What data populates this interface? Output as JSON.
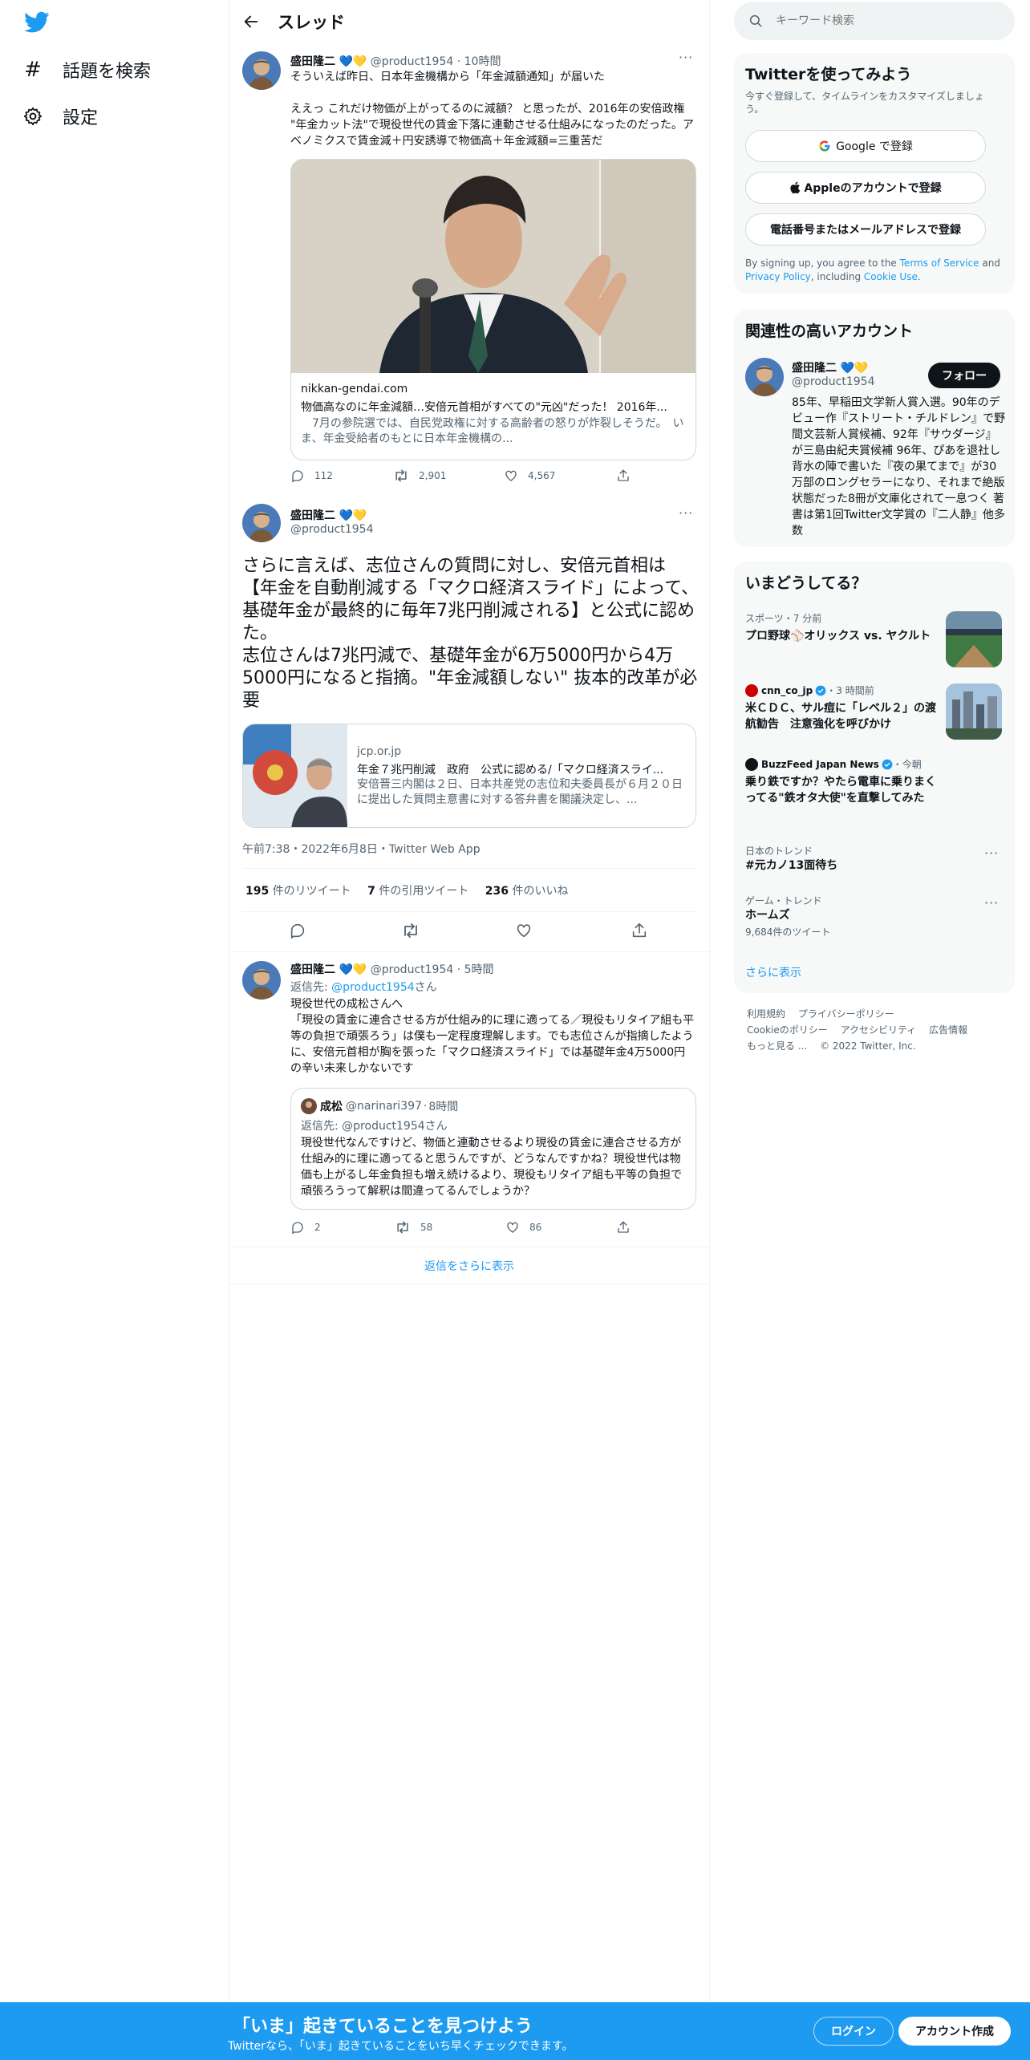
{
  "nav": {
    "explore_label": "話題を検索",
    "settings_label": "設定"
  },
  "header": {
    "title": "スレッド"
  },
  "tweet1": {
    "name": "盛田隆二",
    "handle": "@product1954",
    "time": "10時間",
    "text": "そういえば昨日、日本年金機構から「年金減額通知」が届いた\n\nええっ これだけ物価が上がってるのに減額？ と思ったが、2016年の安倍政権 \"年金カット法\"で現役世代の賃金下落に連動させる仕組みになったのだった。アベノミクスで賃金減＋円安誘導で物価高＋年金減額=三重苦だ",
    "card_domain": "nikkan-gendai.com",
    "card_title": "物価高なのに年金減額…安倍元首相がすべての\"元凶\"だった！ 2016年...",
    "card_desc": "　7月の参院選では、自民党政権に対する高齢者の怒りが炸裂しそうだ。　いま、年金受給者のもとに日本年金機構の...",
    "replies": "112",
    "retweets": "2,901",
    "likes": "4,567"
  },
  "tweet2": {
    "name": "盛田隆二",
    "handle": "@product1954",
    "text": "さらに言えば、志位さんの質問に対し、安倍元首相は【年金を自動削減する「マクロ経済スライド」によって、基礎年金が最終的に毎年7兆円削減される】と公式に認めた。\n志位さんは7兆円減で、基礎年金が6万5000円から4万5000円になると指摘。\"年金減額しない\" 抜本的改革が必要",
    "card_domain": "jcp.or.jp",
    "card_title": "年金７兆円削減　政府　公式に認める/「マクロ経済スライ...",
    "card_desc": "安倍晋三内閣は２日、日本共産党の志位和夫委員長が６月２０日に提出した質問主意書に対する答弁書を閣議決定し、...",
    "timestamp": "午前7:38・2022年6月8日・Twitter Web App",
    "rt_count": "195",
    "rt_label": "件のリツイート",
    "qt_count": "7",
    "qt_label": "件の引用ツイート",
    "like_count": "236",
    "like_label": "件のいいね"
  },
  "tweet3": {
    "name": "盛田隆二",
    "handle": "@product1954",
    "time": "5時間",
    "reply_prefix": "返信先: ",
    "reply_to": "@product1954",
    "reply_suffix": "さん",
    "text": "現役世代の成松さんへ\n「現役の賃金に連合させる方が仕組み的に理に適ってる／現役もリタイア組も平等の負担で頑張ろう」は僕も一定程度理解します。でも志位さんが指摘したように、安倍元首相が胸を張った「マクロ経済スライド」では基礎年金4万5000円の辛い未来しかないです",
    "quote_name": "成松",
    "quote_handle": "@narinari397",
    "quote_time": "8時間",
    "quote_reply": "返信先: @product1954さん",
    "quote_text": "現役世代なんですけど、物価と連動させるより現役の賃金に連合させる方が仕組み的に理に適ってると思うんですが、どうなんですかね？現役世代は物価も上がるし年金負担も増え続けるより、現役もリタイア組も平等の負担で頑張ろうって解釈は間違ってるんでしょうか？",
    "replies": "2",
    "retweets": "58",
    "likes": "86"
  },
  "show_more_replies": "返信をさらに表示",
  "search": {
    "placeholder": "キーワード検索"
  },
  "signup": {
    "title": "Twitterを使ってみよう",
    "subtitle": "今すぐ登録して、タイムラインをカスタマイズしましょう。",
    "google": "Google で登録",
    "apple": "Appleのアカウントで登録",
    "phone": "電話番号またはメールアドレスで登録",
    "terms_1": "By signing up, you agree to the ",
    "terms_link1": "Terms of Service",
    "terms_2": " and ",
    "terms_link2": "Privacy Policy",
    "terms_3": ", including ",
    "terms_link3": "Cookie Use",
    "terms_4": "."
  },
  "related": {
    "title": "関連性の高いアカウント",
    "name": "盛田隆二",
    "handle": "@product1954",
    "follow": "フォロー",
    "bio": "85年、早稲田文学新人賞入選。90年のデビュー作『ストリート・チルドレン』で野間文芸新人賞候補、92年『サウダージ』が三島由紀夫賞候補 96年、ぴあを退社し背水の陣で書いた『夜の果てまで』が30万部のロングセラーになり、それまで絶版状態だった8冊が文庫化されて一息つく 著書は第1回Twitter文学賞の『二人静』他多数"
  },
  "trends": {
    "title": "いまどうしてる？",
    "items": [
      {
        "meta": "スポーツ・7 分前",
        "title": "プロ野球⚾オリックス vs. ヤクルト"
      },
      {
        "source": "cnn_co_jp",
        "meta": "・3 時間前",
        "title": "米ＣＤＣ、サル痘に「レベル２」の渡航勧告　注意強化を呼びかけ"
      },
      {
        "source": "BuzzFeed Japan News",
        "meta": "・今朝",
        "title": "乗り鉄ですか？やたら電車に乗りまくってる\"鉄オタ大使\"を直撃してみた"
      },
      {
        "meta": "日本のトレンド",
        "title": "#元カノ13面待ち"
      },
      {
        "meta": "ゲーム・トレンド",
        "title": "ホームズ",
        "sub": "9,684件のツイート"
      }
    ],
    "show_more": "さらに表示"
  },
  "footer": {
    "l1": "利用規約",
    "l2": "プライバシーポリシー",
    "l3": "Cookieのポリシー",
    "l4": "アクセシビリティ",
    "l5": "広告情報",
    "l6": "もっと見る ...",
    "copy": "© 2022 Twitter, Inc."
  },
  "bottombar": {
    "title": "「いま」起きていることを見つけよう",
    "sub": "Twitterなら、「いま」起きていることをいち早くチェックできます。",
    "login": "ログイン",
    "signup": "アカウント作成"
  },
  "colors": {
    "accent": "#1d9bf0",
    "text": "#0f1419",
    "muted": "#536471",
    "border": "#eff3f4"
  }
}
